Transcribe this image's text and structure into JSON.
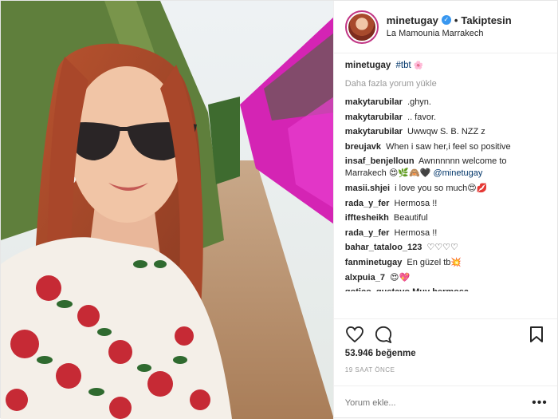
{
  "post": {
    "header": {
      "username": "minetugay",
      "follow_status": "Takiptesin",
      "separator": "•",
      "location": "La Mamounia Marrakech"
    },
    "caption": {
      "user": "minetugay",
      "hashtag": "#tbt",
      "emoji": "🌸"
    },
    "load_more": "Daha fazla yorum yükle",
    "comments": [
      {
        "user": "makytarubilar",
        "text": ".ghyn."
      },
      {
        "user": "makytarubilar",
        "text": ".. favor."
      },
      {
        "user": "makytarubilar",
        "text": "Uwwqw S. B. NZZ z"
      },
      {
        "user": "breujavk",
        "text": "When i saw her,i feel so positive"
      },
      {
        "user": "insaf_benjelloun",
        "text": "Awnnnnnn welcome to Marrakech 😍🌿🙈🖤 ",
        "mention": "@minetugay"
      },
      {
        "user": "masii.shjei",
        "text": "i love you so much😍💋"
      },
      {
        "user": "rada_y_fer",
        "text": "Hermosa !!"
      },
      {
        "user": "ifftesheikh",
        "text": "Beautiful"
      },
      {
        "user": "rada_y_fer",
        "text": "Hermosa !!"
      },
      {
        "user": "bahar_tataloo_123",
        "text": "♡♡♡♡"
      },
      {
        "user": "fanminetugay",
        "text": "En güzel tb💥"
      },
      {
        "user": "alxpuia_7",
        "text": "😍💖"
      }
    ],
    "partial_comment": "gotico_gustavo Muy hermosa",
    "likes": "53.946 beğenme",
    "timestamp": "19 SAAT ÖNCE",
    "comment_placeholder": "Yorum ekle...",
    "more_label": "•••"
  }
}
